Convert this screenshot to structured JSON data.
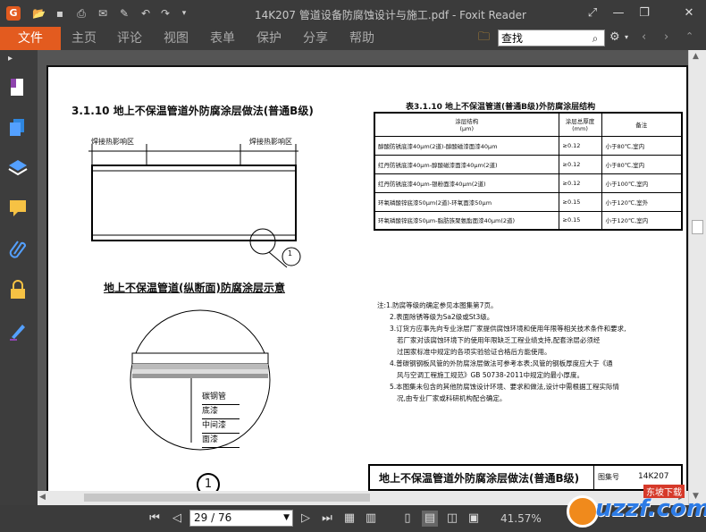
{
  "app": {
    "title": "14K207 管道设备防腐蚀设计与施工.pdf - Foxit Reader",
    "logo_letter": "G",
    "brand_color": "#e35b1f"
  },
  "menu": {
    "file": "文件",
    "items": [
      "主页",
      "评论",
      "视图",
      "表单",
      "保护",
      "分享",
      "帮助"
    ]
  },
  "search": {
    "value": "查找"
  },
  "page_nav": {
    "current": "29 / 76",
    "zoom": "41.57%"
  },
  "document": {
    "left_title": "3.1.10 地上不保温管道外防腐涂层做法(普通B级)",
    "weld_left": "焊接热影响区",
    "weld_right": "焊接热影响区",
    "detail_num": "1",
    "section_title": "地上不保温管道(纵断面)防腐涂层示意",
    "layers": [
      "碳钢管",
      "底漆",
      "中间漆",
      "面漆"
    ],
    "circle_label": "1",
    "table_title": "表3.1.10 地上不保温管道(普通B级)外防腐涂层结构",
    "table_headers": [
      "涂层结构\n(μm)",
      "涂层总厚度\n(mm)",
      "备注"
    ],
    "table_rows": [
      [
        "醇酸防锈底漆40μm(2道)-醇酸磁漆面漆40μm",
        "≥0.12",
        "小于80℃,室内"
      ],
      [
        "红丹防锈底漆40μm-醇酸磁漆面漆40μm(2道)",
        "≥0.12",
        "小于80℃,室内"
      ],
      [
        "红丹防锈底漆40μm-银粉面漆40μm(2道)",
        "≥0.12",
        "小于100℃,室内"
      ],
      [
        "环氧磷酸锌底漆50μm(2道)-环氧面漆50μm",
        "≥0.15",
        "小于120℃,室外"
      ],
      [
        "环氧磷酸锌底漆50μm-脂肪族聚氨酯面漆40μm(2道)",
        "≥0.15",
        "小于120℃,室内"
      ]
    ],
    "notes": [
      "注:1.防腐等级的确定参见本图集第7页。",
      "2.表面除锈等级为Sa2级或St3级。",
      "3.订货方应事先向专业涂层厂家提供腐蚀环境和使用年限等相关技术条件和要求,",
      "若厂家对该腐蚀环境下的使用年限缺乏工程业绩支持,配套涂层必须经",
      "过国家标准中规定的各项实验验证合格后方能使用。",
      "4.普碳钢钢板风管的外防腐涂层做法可参考本表;风管的钢板厚度应大于《通",
      "风与空调工程施工规范》GB 50738-2011中规定的最小厚度。",
      "5.本图集未包含的其他防腐蚀设计环境、要求和做法,设计中需根据工程实际情",
      "况,由专业厂家或科研机构配合确定。"
    ],
    "footer_title": "地上不保温管道外防腐涂层做法(普通B级)",
    "footer_label": "图集号",
    "footer_code": "14K207"
  },
  "watermark": {
    "text": "uzzf.com",
    "sub": "东坡下载"
  }
}
